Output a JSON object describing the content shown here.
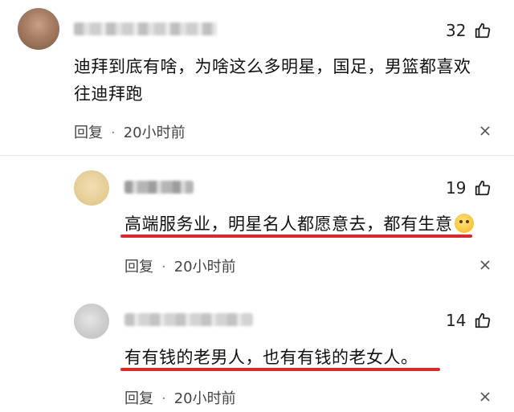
{
  "comments": [
    {
      "likes": "32",
      "text_line1": "迪拜到底有啥，为啥这么多明星，国足，男篮都喜欢",
      "text_line2": "往迪拜跑",
      "reply_label": "回复",
      "separator": "·",
      "time": "20小时前"
    },
    {
      "likes": "19",
      "text": "高端服务业，明星名人都愿意去，都有生意",
      "emoji": "thinking-face-emoji",
      "reply_label": "回复",
      "separator": "·",
      "time": "20小时前"
    },
    {
      "likes": "14",
      "text": "有有钱的老男人，也有有钱的老女人。",
      "reply_label": "回复",
      "separator": "·",
      "time": "20小时前"
    }
  ],
  "icons": {
    "like": "thumbs-up-icon",
    "dismiss": "close-icon"
  },
  "colors": {
    "highlight_underline": "#d82a2a"
  }
}
